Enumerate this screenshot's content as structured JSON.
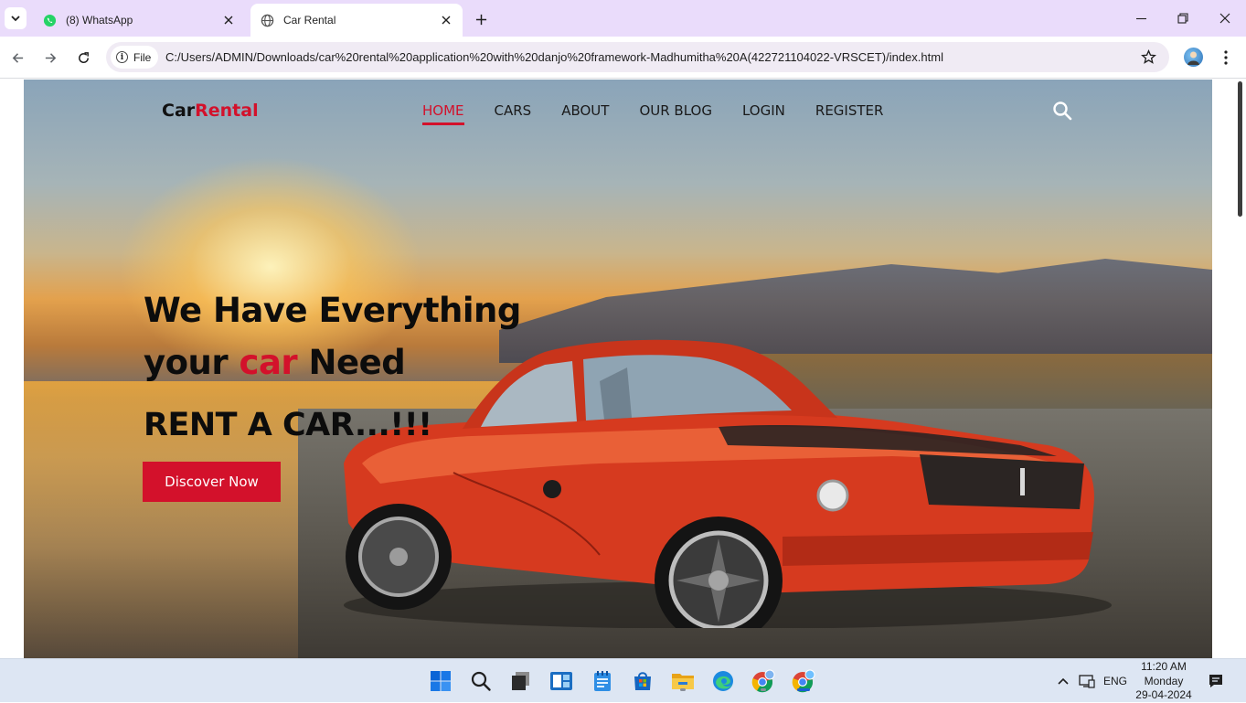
{
  "browser": {
    "tabs": [
      {
        "label": "(8) WhatsApp",
        "icon": "whatsapp-icon",
        "active": false
      },
      {
        "label": "Car Rental",
        "icon": "globe-icon",
        "active": true
      }
    ],
    "address": {
      "scheme_chip": "File",
      "url": "C:/Users/ADMIN/Downloads/car%20rental%20application%20with%20danjo%20framework-Madhumitha%20A(422721104022-VRSCET)/index.html"
    }
  },
  "site": {
    "logo_part1": "Car",
    "logo_part2": "Rental",
    "nav": [
      {
        "label": "HOME",
        "active": true
      },
      {
        "label": "CARS",
        "active": false
      },
      {
        "label": "ABOUT",
        "active": false
      },
      {
        "label": "OUR BLOG",
        "active": false
      },
      {
        "label": "LOGIN",
        "active": false
      },
      {
        "label": "REGISTER",
        "active": false
      }
    ],
    "hero": {
      "line1": "We Have Everything",
      "line2_a": "your ",
      "line2_highlight": "car",
      "line2_b": " Need",
      "subheading": "RENT A CAR...!!!",
      "cta_label": "Discover Now"
    },
    "colors": {
      "accent": "#d3112b",
      "text": "#0c0c0c"
    }
  },
  "taskbar": {
    "apps": [
      "windows-start-icon",
      "search-icon",
      "task-view-icon",
      "widgets-icon",
      "notepad-icon",
      "store-icon",
      "file-explorer-icon",
      "edge-icon",
      "chrome-icon",
      "chrome-active-icon"
    ],
    "language": "ENG",
    "time": "11:20 AM",
    "day": "Monday",
    "date": "29-04-2024"
  }
}
